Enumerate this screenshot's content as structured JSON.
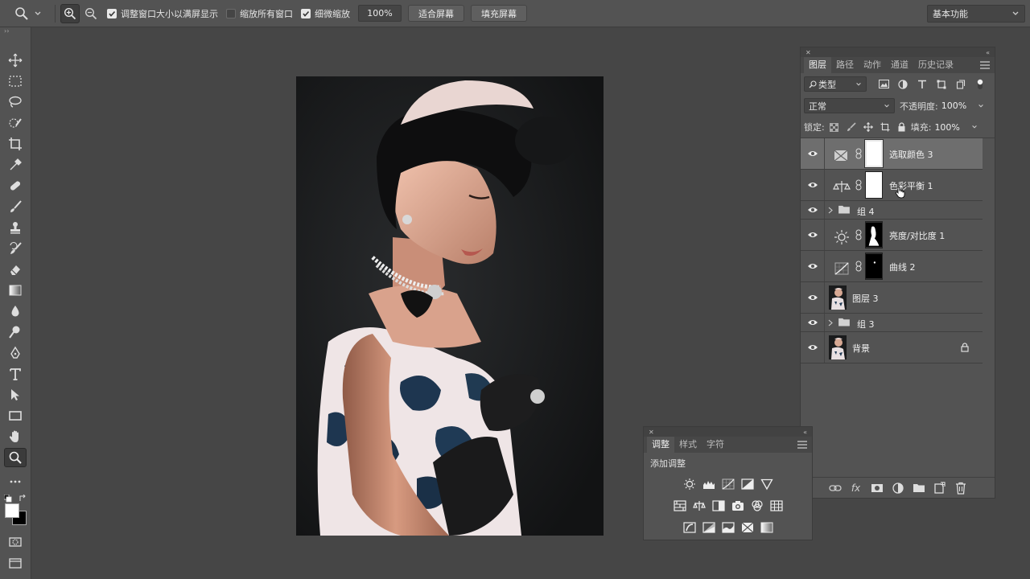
{
  "options_bar": {
    "checkbox_resize_label": "调整窗口大小以满屏显示",
    "checkbox_zoom_all_label": "缩放所有窗口",
    "checkbox_scrubby_label": "细微缩放",
    "zoom_value": "100%",
    "fit_screen_label": "适合屏幕",
    "fill_screen_label": "填充屏幕",
    "workspace_label": "基本功能"
  },
  "layers_panel": {
    "tabs": [
      "图层",
      "路径",
      "动作",
      "通道",
      "历史记录"
    ],
    "filter_label": "类型",
    "blend_mode": "正常",
    "opacity_label": "不透明度:",
    "opacity_value": "100%",
    "lock_label": "锁定:",
    "fill_label": "填充:",
    "fill_value": "100%",
    "layers": [
      {
        "name": "选取颜色 3",
        "type": "adjustment-selective-color",
        "selected": true
      },
      {
        "name": "色彩平衡 1",
        "type": "adjustment-color-balance",
        "selected": false
      },
      {
        "name": "组 4",
        "type": "group",
        "selected": false
      },
      {
        "name": "亮度/对比度 1",
        "type": "adjustment-brightness-contrast",
        "selected": false
      },
      {
        "name": "曲线 2",
        "type": "adjustment-curves",
        "selected": false
      },
      {
        "name": "图层 3",
        "type": "pixel",
        "selected": false
      },
      {
        "name": "组 3",
        "type": "group",
        "selected": false
      },
      {
        "name": "背景",
        "type": "background",
        "selected": false,
        "locked": true
      }
    ]
  },
  "adjustments_panel": {
    "tabs": [
      "调整",
      "样式",
      "字符"
    ],
    "heading": "添加调整"
  },
  "colors": {
    "panel_bg": "#535353",
    "canvas_bg": "#464646",
    "selected_layer": "#6e6e6e"
  }
}
